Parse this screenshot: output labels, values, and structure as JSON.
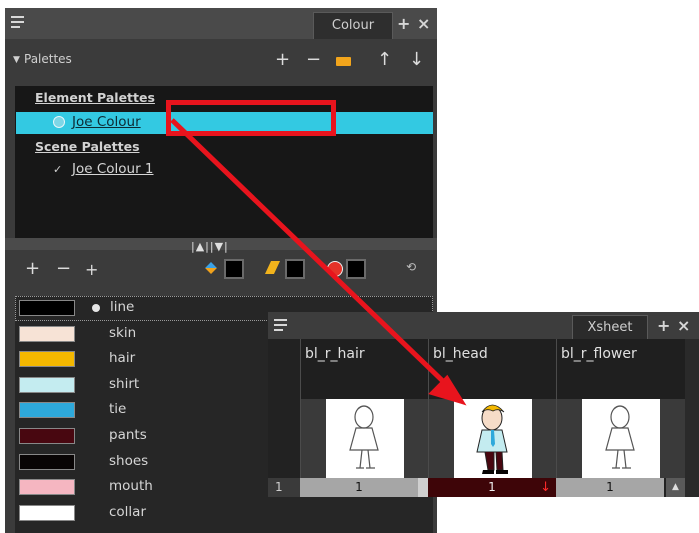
{
  "colour_panel": {
    "tab_label": "Colour",
    "title_add": "+",
    "title_close": "×",
    "palettes_label": "Palettes",
    "palette_toolbar": [
      "+",
      "−",
      "▬",
      "↑",
      "↓"
    ],
    "element_palettes_header": "Element Palettes",
    "element_palettes": [
      {
        "label": "Joe Colour",
        "selected": true
      }
    ],
    "scene_palettes_header": "Scene Palettes",
    "scene_palettes": [
      {
        "label": "Joe Colour 1",
        "selected": false
      }
    ],
    "swatch_toolbar": [
      "+",
      "−",
      "+"
    ],
    "swatches": [
      {
        "name": "line",
        "color": "#000000",
        "selected": true
      },
      {
        "name": "skin",
        "color": "#f7e3d6"
      },
      {
        "name": "hair",
        "color": "#f4b800"
      },
      {
        "name": "shirt",
        "color": "#c4ecf0"
      },
      {
        "name": "tie",
        "color": "#2ea9db"
      },
      {
        "name": "pants",
        "color": "#480710"
      },
      {
        "name": "shoes",
        "color": "#080404"
      },
      {
        "name": "mouth",
        "color": "#f5b6c1"
      },
      {
        "name": "collar",
        "color": "#ffffff"
      }
    ]
  },
  "xsheet_panel": {
    "tab_label": "Xsheet",
    "title_add": "+",
    "title_close": "×",
    "columns": [
      {
        "name": "bl_r_hair",
        "cell": "1",
        "colored": false
      },
      {
        "name": "bl_head",
        "cell": "1",
        "colored": true
      },
      {
        "name": "bl_r_flower",
        "cell": "1",
        "colored": false
      }
    ],
    "frame_number": "1",
    "scroll_up": "▲"
  },
  "annotation": {
    "color": "#e8141d"
  }
}
